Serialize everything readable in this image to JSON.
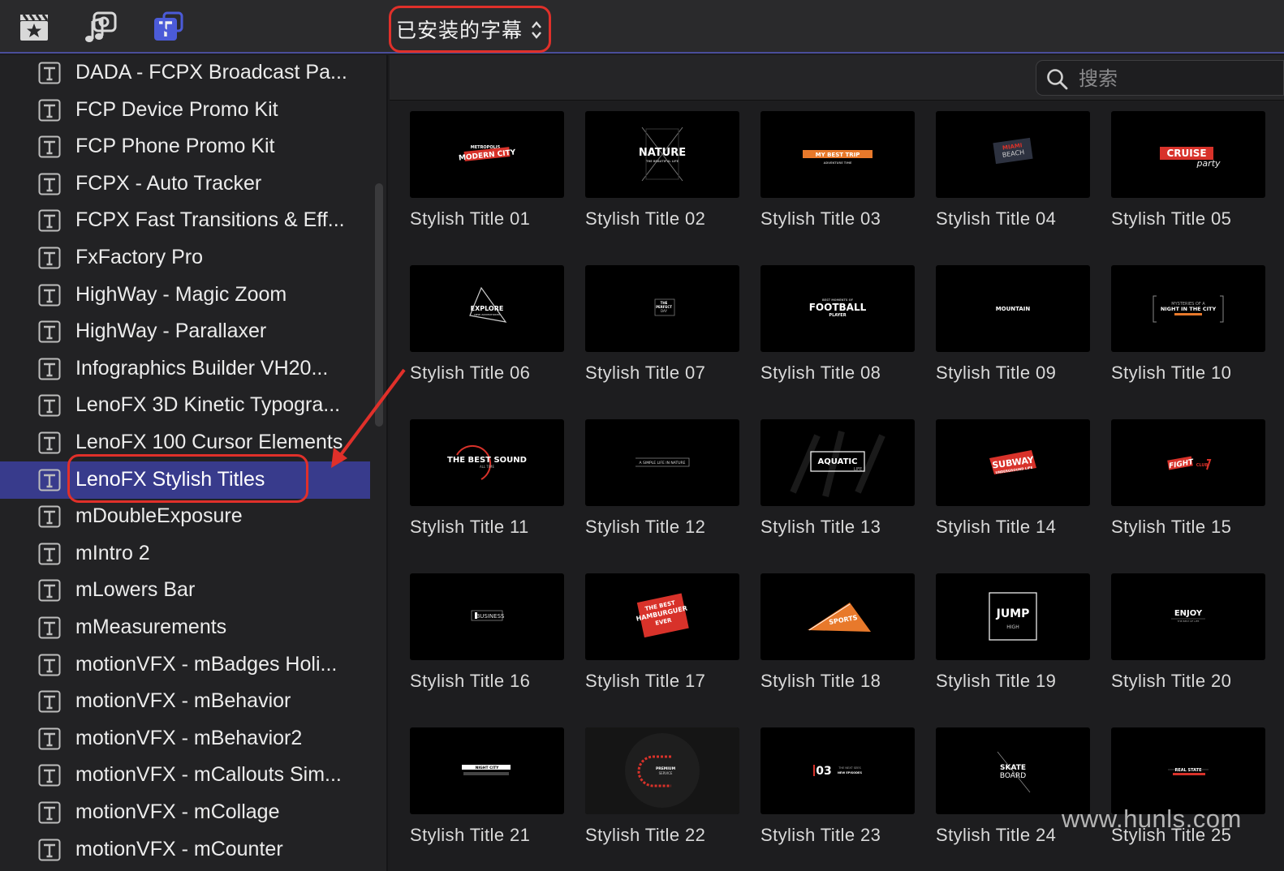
{
  "toolbar": {
    "selector_label": "已安装的字幕",
    "icons": [
      "clapper-star-icon",
      "music-photo-icon",
      "titles-icon"
    ]
  },
  "sidebar": {
    "items": [
      {
        "label": "DADA - FCPX Broadcast Pa..."
      },
      {
        "label": "FCP Device Promo Kit"
      },
      {
        "label": "FCP Phone Promo Kit"
      },
      {
        "label": "FCPX - Auto Tracker"
      },
      {
        "label": "FCPX Fast Transitions & Eff..."
      },
      {
        "label": "FxFactory Pro"
      },
      {
        "label": "HighWay - Magic Zoom"
      },
      {
        "label": "HighWay - Parallaxer"
      },
      {
        "label": "Infographics Builder VH20..."
      },
      {
        "label": "LenoFX 3D Kinetic Typogra..."
      },
      {
        "label": "LenoFX 100 Cursor Elements"
      },
      {
        "label": "LenoFX Stylish Titles",
        "selected": true
      },
      {
        "label": "mDoubleExposure"
      },
      {
        "label": "mIntro 2"
      },
      {
        "label": "mLowers Bar"
      },
      {
        "label": "mMeasurements"
      },
      {
        "label": "motionVFX - mBadges Holi..."
      },
      {
        "label": "motionVFX - mBehavior"
      },
      {
        "label": "motionVFX - mBehavior2"
      },
      {
        "label": "motionVFX - mCallouts Sim..."
      },
      {
        "label": "motionVFX - mCollage"
      },
      {
        "label": "motionVFX - mCounter"
      }
    ]
  },
  "search": {
    "placeholder": "搜索",
    "value": ""
  },
  "tiles": [
    {
      "label": "Stylish Title 01",
      "art": [
        "METROPOLIS",
        "MODERN CITY"
      ]
    },
    {
      "label": "Stylish Title 02",
      "art": [
        "NATURE",
        "THE BEAUTIFUL LIFE"
      ]
    },
    {
      "label": "Stylish Title 03",
      "art": [
        "MY BEST TRIP",
        "ADVENTURE TIME"
      ]
    },
    {
      "label": "Stylish Title 04",
      "art": [
        "MIAMI",
        "BEACH"
      ]
    },
    {
      "label": "Stylish Title 05",
      "art": [
        "CRUISE",
        "party"
      ]
    },
    {
      "label": "Stylish Title 06",
      "art": [
        "EXPLORE",
        "NEW ADVENTURES"
      ]
    },
    {
      "label": "Stylish Title 07",
      "art": [
        "THE",
        "PERFECT",
        "DAY"
      ]
    },
    {
      "label": "Stylish Title 08",
      "art": [
        "BEST MOMENTS OF",
        "FOOTBALL",
        "PLAYER"
      ]
    },
    {
      "label": "Stylish Title 09",
      "art": [
        "MOUNTAIN"
      ]
    },
    {
      "label": "Stylish Title 10",
      "art": [
        "MYSTERIES OF A",
        "NIGHT IN THE CITY"
      ]
    },
    {
      "label": "Stylish Title 11",
      "art": [
        "THE BEST SOUND",
        "ALL TIME"
      ]
    },
    {
      "label": "Stylish Title 12",
      "art": [
        "A SIMPLE LIFE IN NATURE"
      ]
    },
    {
      "label": "Stylish Title 13",
      "art": [
        "AQUATIC",
        "LIFE"
      ]
    },
    {
      "label": "Stylish Title 14",
      "art": [
        "SUBWAY",
        "UNDERGROUND LIFE"
      ]
    },
    {
      "label": "Stylish Title 15",
      "art": [
        "FIGHT",
        "CLUB"
      ]
    },
    {
      "label": "Stylish Title 16",
      "art": [
        "BUSINESS"
      ]
    },
    {
      "label": "Stylish Title 17",
      "art": [
        "THE BEST",
        "HAMBURGUER",
        "EVER"
      ]
    },
    {
      "label": "Stylish Title 18",
      "art": [
        "SPORTS"
      ]
    },
    {
      "label": "Stylish Title 19",
      "art": [
        "JUMP",
        "HIGH"
      ]
    },
    {
      "label": "Stylish Title 20",
      "art": [
        "ENJOY",
        "THE BEST OF LIFE"
      ]
    },
    {
      "label": "Stylish Title 21",
      "art": [
        "NIGHT CITY"
      ]
    },
    {
      "label": "Stylish Title 22",
      "art": [
        "PREMIUM",
        "SERVICE"
      ]
    },
    {
      "label": "Stylish Title 23",
      "art": [
        "03",
        "THE NEXT SEES",
        "NEW EPISODES"
      ]
    },
    {
      "label": "Stylish Title 24",
      "art": [
        "SKATE",
        "BOARD"
      ]
    },
    {
      "label": "Stylish Title 25",
      "art": [
        "REAL STATE"
      ]
    }
  ],
  "watermark": "www.hunls.com",
  "colors": {
    "accent": "#383b8c",
    "highlight": "#e0302a",
    "orange": "#e8792b",
    "red": "#d8322a"
  }
}
